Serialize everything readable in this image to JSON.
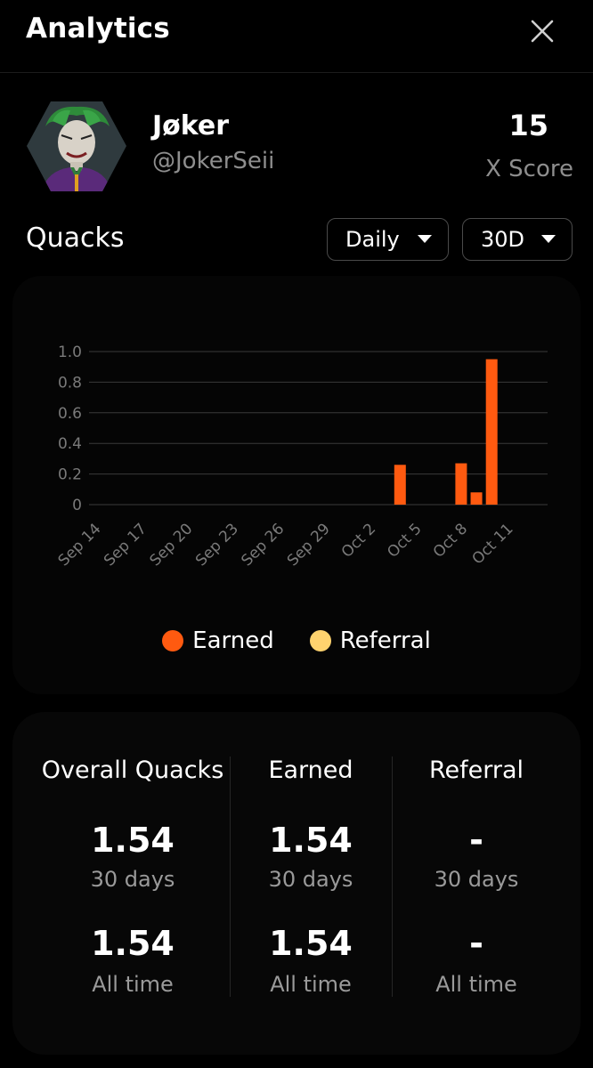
{
  "header": {
    "title": "Analytics",
    "close_icon": "close-icon"
  },
  "profile": {
    "name": "Jøker",
    "handle": "@JokerSeii",
    "score_value": "15",
    "score_label": "X Score"
  },
  "quacks": {
    "title": "Quacks",
    "interval_dropdown": "Daily",
    "range_dropdown": "30D"
  },
  "colors": {
    "earned": "#ff5a10",
    "referral": "#ffd36e",
    "grid": "#3a3a3a",
    "tick": "#7a7a7a"
  },
  "chart_data": {
    "type": "bar",
    "x_tick_labels": [
      "Sep 14",
      "Sep 17",
      "Sep 20",
      "Sep 23",
      "Sep 26",
      "Sep 29",
      "Oct 2",
      "Oct 5",
      "Oct 8",
      "Oct 11"
    ],
    "y_tick_labels": [
      "0",
      "0.2",
      "0.4",
      "0.6",
      "0.8",
      "1.0"
    ],
    "ylim": [
      0,
      1.0
    ],
    "grid": true,
    "legend_position": "bottom",
    "series": [
      {
        "name": "Earned",
        "color": "#ff5a10",
        "points": [
          {
            "x": "Oct 6",
            "y": 0.26
          },
          {
            "x": "Oct 10",
            "y": 0.27
          },
          {
            "x": "Oct 11",
            "y": 0.08
          },
          {
            "x": "Oct 12",
            "y": 0.95
          }
        ]
      },
      {
        "name": "Referral",
        "color": "#ffd36e",
        "points": []
      }
    ]
  },
  "legend": {
    "earned": "Earned",
    "referral": "Referral"
  },
  "stats": {
    "overall": {
      "title": "Overall Quacks",
      "value_30d": "1.54",
      "label_30d": "30 days",
      "value_all": "1.54",
      "label_all": "All time"
    },
    "earned": {
      "title": "Earned",
      "value_30d": "1.54",
      "label_30d": "30 days",
      "value_all": "1.54",
      "label_all": "All time"
    },
    "referral": {
      "title": "Referral",
      "value_30d": "-",
      "label_30d": "30 days",
      "value_all": "-",
      "label_all": "All time"
    }
  }
}
